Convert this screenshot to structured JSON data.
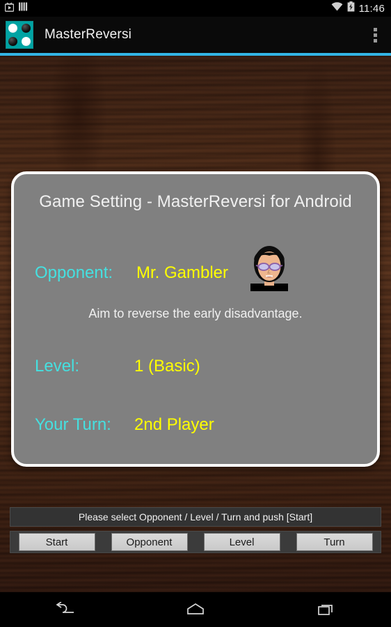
{
  "status_bar": {
    "left_icons": [
      "play-store-icon",
      "striped-bars-icon"
    ],
    "right_icons": [
      "wifi-icon",
      "battery-charging-icon"
    ],
    "clock": "11:46"
  },
  "action_bar": {
    "app_icon": "reversi-board-icon",
    "title": "MasterReversi",
    "overflow": "overflow-menu-icon",
    "accent_color": "#33b5e5"
  },
  "dialog": {
    "title": "Game Setting - MasterReversi for Android",
    "opponent": {
      "label": "Opponent:",
      "value": "Mr. Gambler",
      "avatar": "gambler-face-avatar",
      "description": "Aim to reverse the early disadvantage."
    },
    "level": {
      "label": "Level:",
      "value": "1 (Basic)"
    },
    "turn": {
      "label": "Your Turn:",
      "value": "2nd Player"
    },
    "label_color": "#45e0e0",
    "value_color": "#ffff00",
    "panel_color": "#808080"
  },
  "footer": {
    "message": "Please select Opponent / Level / Turn and push [Start]",
    "buttons": [
      {
        "label": "Start"
      },
      {
        "label": "Opponent"
      },
      {
        "label": "Level"
      },
      {
        "label": "Turn"
      }
    ]
  },
  "nav_bar": {
    "back": "back-icon",
    "home": "home-icon",
    "recents": "recents-icon"
  }
}
